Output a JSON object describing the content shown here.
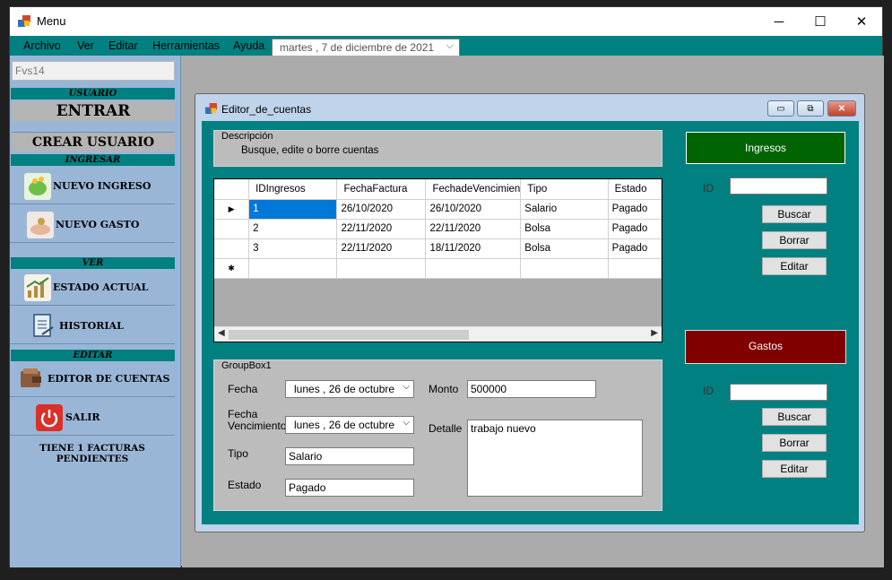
{
  "window": {
    "title": "Menu",
    "minimize": "─",
    "maximize": "☐",
    "close": "✕"
  },
  "menu": {
    "items": [
      "Archivo",
      "Ver",
      "Editar",
      "Herramientas",
      "Ayuda"
    ],
    "date": "martes  ,   7 de  diciembre  de  2021"
  },
  "sidebar": {
    "user_value": "Fvs14",
    "sec_usuario": "USUARIO",
    "entrar": "ENTRAR",
    "crear_usuario": "CREAR USUARIO",
    "sec_ingresar": "INGRESAR",
    "nuevo_ingreso": "NUEVO INGRESO",
    "nuevo_gasto": "NUEVO GASTO",
    "sec_ver": "VER",
    "estado_actual": "ESTADO ACTUAL",
    "historial": "HISTORIAL",
    "sec_editar": "EDITAR",
    "editor_cuentas": "EDITOR DE CUENTAS",
    "salir": "SALIR",
    "pending": "TIENE 1 FACTURAS PENDIENTES"
  },
  "child": {
    "title": "Editor_de_cuentas",
    "desc_title": "Descripción",
    "desc_text": "Busque, edite o borre cuentas",
    "grid": {
      "headers": [
        "IDIngresos",
        "FechaFactura",
        "FechadeVencimien",
        "Tipo",
        "Estado"
      ],
      "rows": [
        [
          "1",
          "26/10/2020",
          "26/10/2020",
          "Salario",
          "Pagado"
        ],
        [
          "2",
          "22/11/2020",
          "22/11/2020",
          "Bolsa",
          "Pagado"
        ],
        [
          "3",
          "22/11/2020",
          "18/11/2020",
          "Bolsa",
          "Pagado"
        ]
      ],
      "current_marker": "▶",
      "new_marker": "✱"
    },
    "form": {
      "group_title": "GroupBox1",
      "fecha_label": "Fecha",
      "fecha_value": "lunes    , 26 de    octubre",
      "venc_label": "Fecha\nVencimiento",
      "venc_value": "lunes    , 26 de    octubre",
      "tipo_label": "Tipo",
      "tipo_value": "Salario",
      "estado_label": "Estado",
      "estado_value": "Pagado",
      "monto_label": "Monto",
      "monto_value": "500000",
      "detalle_label": "Detalle",
      "detalle_value": "trabajo nuevo"
    },
    "ingresos": {
      "title": "Ingresos",
      "id_label": "ID",
      "id_value": "",
      "buscar": "Buscar",
      "borrar": "Borrar",
      "editar": "Editar",
      "color": "#006400"
    },
    "gastos": {
      "title": "Gastos",
      "id_label": "ID",
      "id_value": "",
      "buscar": "Buscar",
      "borrar": "Borrar",
      "editar": "Editar",
      "color": "#800000"
    }
  }
}
